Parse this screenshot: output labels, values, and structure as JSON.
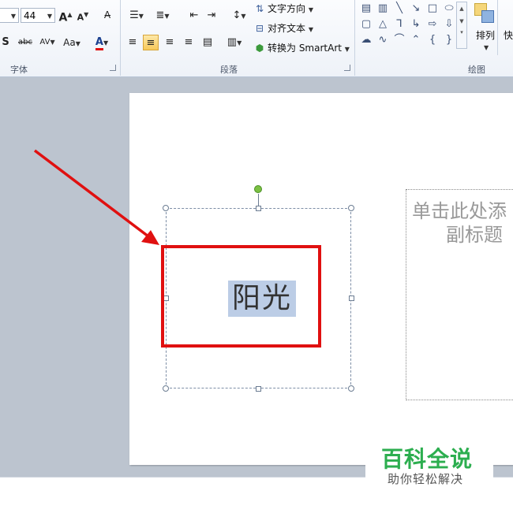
{
  "ribbon": {
    "font_group": {
      "label": "字体",
      "font_size": "44",
      "grow_font": "A",
      "shrink_font": "A",
      "shadow": "S",
      "strikethrough": "abc",
      "char_spacing": "AV",
      "change_case": "Aa",
      "font_color": "A",
      "font_color_accent": "#e01010"
    },
    "paragraph_group": {
      "label": "段落",
      "text_direction": "文字方向",
      "align_text": "对齐文本",
      "convert_smartart": "转换为 SmartArt"
    },
    "drawing_group": {
      "label": "绘图",
      "arrange": "排列",
      "quick_styles": "快"
    }
  },
  "slide": {
    "title_text": "阳光",
    "subtitle_line1": "单击此处添",
    "subtitle_line2": "副标题"
  },
  "watermark": {
    "main": "百科全说",
    "sub": "助你轻松解决",
    "color": "#2cae4f"
  },
  "annotation": {
    "color": "#e01010"
  }
}
